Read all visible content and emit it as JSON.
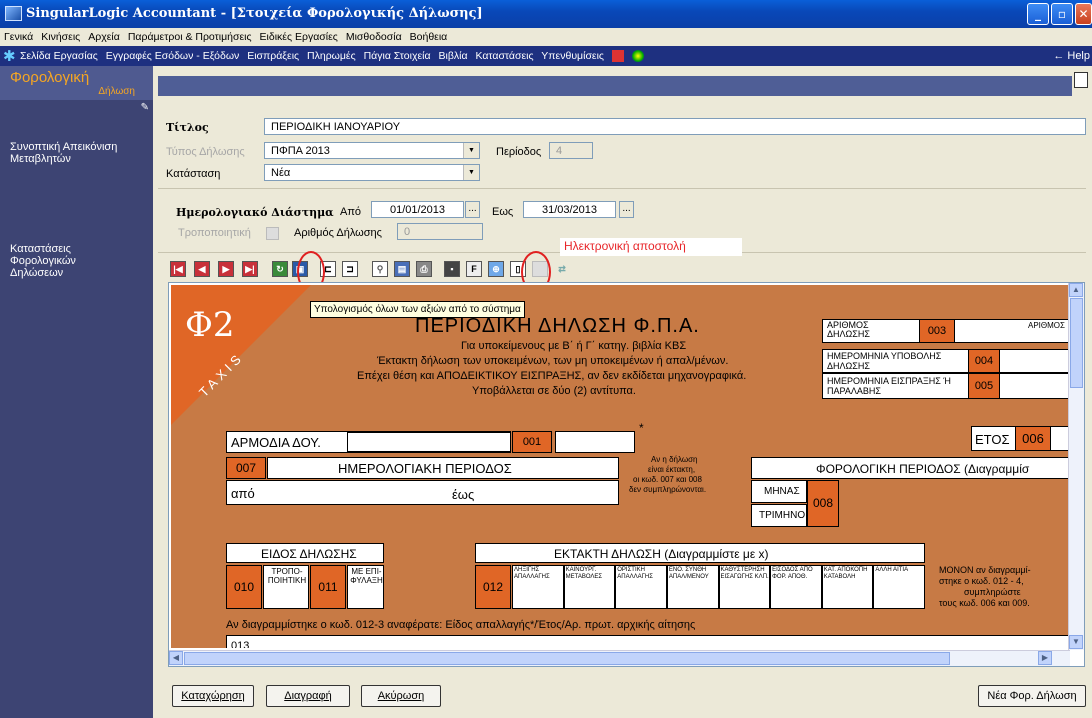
{
  "window": {
    "title": "SingularLogic Accountant - [Στοιχεία Φορολογικής Δήλωσης]",
    "min": "_",
    "max": "▫",
    "close": "✕"
  },
  "menu": [
    "Γενικά",
    "Κινήσεις",
    "Αρχεία",
    "Παράμετροι & Προτιμήσεις",
    "Ειδικές Εργασίες",
    "Μισθοδοσία",
    "Βοήθεια"
  ],
  "nav": {
    "items": [
      "Σελίδα Εργασίας",
      "Εγγραφές Εσόδων - Εξόδων",
      "Εισπράξεις",
      "Πληρωμές",
      "Πάγια Στοιχεία",
      "Βιβλία",
      "Καταστάσεις",
      "Υπενθυμίσεις"
    ],
    "help": "Help"
  },
  "sidebar": {
    "title": "Φορολογική",
    "subtitle": "Δήλωση",
    "link1": "Συνοπτική Απεικόνιση Μεταβλητών",
    "link2": "Καταστάσεις Φορολογικών Δηλώσεων"
  },
  "header": {
    "title_label": "Τίτλος",
    "title_value": "ΠΕΡΙΟΔΙΚΗ ΙΑΝΟΥΑΡΙΟΥ",
    "type_label": "Τύπος Δήλωσης",
    "type_value": "ΠΦΠΑ 2013",
    "period_label": "Περίοδος",
    "period_value": "4",
    "status_label": "Κατάσταση",
    "status_value": "Νέα",
    "range_label": "Ημερολογιακό Διάστημα",
    "from_label": "Από",
    "from_value": "01/01/2013",
    "to_label": "Εως",
    "to_value": "31/03/2013",
    "amend_label": "Τροποποιητική",
    "declno_label": "Αριθμός Δήλωσης",
    "declno_value": "0",
    "dots": "..."
  },
  "annotation": {
    "red_label": "Ηλεκτρονική αποστολή",
    "tooltip": "Υπολογισμός όλων των αξιών από το σύστημα"
  },
  "form": {
    "logo": "Φ2",
    "taxis": "TAXIS",
    "heading": "ΠΕΡΙΟΔΙΚΗ ΔΗΛΩΣΗ Φ.Π.Α.",
    "line1": "Για υποκείμενους με Β΄ ή Γ΄ κατηγ. βιβλία ΚΒΣ",
    "line2": "Έκτακτη δήλωση των υποκειμένων, των μη υποκειμένων ή απαλ/μένων.",
    "line3": "Επέχει θέση και ΑΠΟΔΕΙΚΤΙΚΟΥ ΕΙΣΠΡΑΞΗΣ, αν δεν εκδίδεται μηχανογραφικά.",
    "line4": "Υποβάλλεται σε δύο (2) αντίτυπα.",
    "arithmos": "ΑΡΙΘΜΟΣ ΔΗΛΩΣΗΣ",
    "arithmos_r": "ΑΡΙΘΜΟΣ",
    "c003": "003",
    "hmer_ypovolis": "ΗΜΕΡΟΜΗΝΙΑ ΥΠΟΒΟΛΗΣ ΔΗΛΩΣΗΣ",
    "c004": "004",
    "hmer_eisp": "ΗΜΕΡΟΜΗΝΙΑ ΕΙΣΠΡΑΞΗΣ Ή ΠΑΡΑΛΑΒΗΣ",
    "c005": "005",
    "armodia": "ΑΡΜΟΔΙΑ ΔΟΥ.",
    "c001": "001",
    "star": "*",
    "etos": "ΕΤΟΣ",
    "c006": "006",
    "c007": "007",
    "imer_per": "ΗΜΕΡΟΛΟΓΙΑΚΗ ΠΕΡΙΟΔΟΣ",
    "apo": "από",
    "eos": "έως",
    "ektakti_note1": "Αν η δήλωση",
    "ektakti_note2": "είναι έκτακτη,",
    "ektakti_note3": "οι κωδ. 007 και 008",
    "ektakti_note4": "δεν συμπληρώνονται.",
    "for_per": "ΦΟΡΟΛΟΓΙΚΗ ΠΕΡΙΟΔΟΣ (Διαγραμμίσ",
    "minas": "ΜΗΝΑΣ",
    "trimino": "ΤΡΙΜΗΝΟ",
    "c008": "008",
    "eidos": "ΕΙΔΟΣ ΔΗΛΩΣΗΣ",
    "c010": "010",
    "tropo": "ΤΡΟΠΟ-ΠΟΙΗΤΙΚΗ",
    "c011": "011",
    "epif": "ΜΕ ΕΠΙ-ΦΥΛΑΞΗ",
    "ektakti": "ΕΚΤΑΚΤΗ ΔΗΛΩΣΗ (Διαγραμμίστε με x)",
    "c012": "012",
    "ekt_cols": [
      "ΛΗΞΙΓΗΣ ΑΠΑΛΛΑΓΗΣ",
      "ΚΑΙΝΟΥΡΓ. ΜΕΤΑΒΟΛΕΣ",
      "ΟΡΙΣΤΙΚΗ ΑΠΑΛΛΑΓΗΣ",
      "ΕΝΟ. ΣΥΝΘΗ ΑΠΑΛ/ΜΕΝΟΥ",
      "ΚΑΘΥΣΤΕΡΗΣΗ ΕΙΣΑΓΩΓΗΣ ΚΛΠ.",
      "ΕΙΣΟΔΟΣ ΑΠΟ ΦΟΡ. ΑΠΟΘ.",
      "ΚΑΤ. ΑΠΟΚΟΠΗ ΚΑΤΑΒΟΛΗ",
      "ΑΛΛΗ ΑΙΤΙΑ"
    ],
    "monon1": "ΜΟΝΟΝ αν διαγραμμί-",
    "monon2": "στηκε ο κωδ. 012 - 4,",
    "monon3": "συμπληρώστε",
    "monon4": "τους κωδ. 006 και 009.",
    "line013": "Αν διαγραμμίστηκε ο κωδ. 012-3 αναφέρατε: Είδος απαλλαγής*/Έτος/Αρ. πρωτ. αρχικής αίτησης",
    "c013": "013"
  },
  "buttons": {
    "save": "Καταχώρηση",
    "delete": "Διαγραφή",
    "cancel": "Ακύρωση",
    "new": "Νέα Φορ. Δήλωση"
  }
}
